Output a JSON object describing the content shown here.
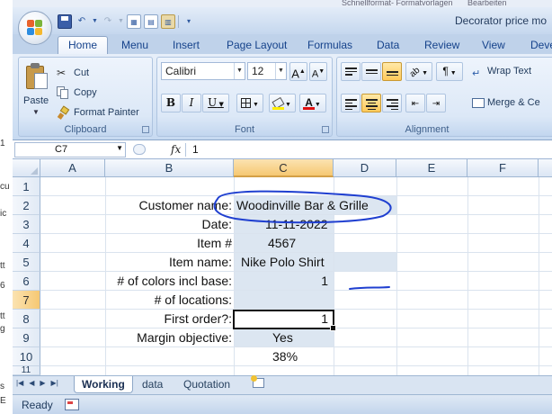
{
  "background": {
    "top_snippets": [
      "Schnellformat- Formatvorlagen",
      "Bearbeiten"
    ],
    "left_snippets": [
      "1",
      "cu",
      "ic",
      "tt",
      "6",
      "tt",
      "g",
      "s",
      "E"
    ]
  },
  "window": {
    "title": "Decorator price mo"
  },
  "ribbon_tabs": [
    "Home",
    "Menu",
    "Insert",
    "Page Layout",
    "Formulas",
    "Data",
    "Review",
    "View",
    "Deve"
  ],
  "clipboard": {
    "paste": "Paste",
    "cut": "Cut",
    "copy": "Copy",
    "format_painter": "Format Painter",
    "label": "Clipboard"
  },
  "font": {
    "name": "Calibri",
    "size": "12",
    "grow": "A",
    "shrink": "A",
    "bold": "B",
    "italic": "I",
    "underline": "U",
    "color_letter": "A",
    "label": "Font"
  },
  "alignment": {
    "wrap_text": "Wrap Text",
    "merge": "Merge & Ce",
    "label": "Alignment"
  },
  "formula_bar": {
    "name_box": "C7",
    "fx": "fx",
    "value": "1"
  },
  "columns": [
    "A",
    "B",
    "C",
    "D",
    "E",
    "F"
  ],
  "rows": [
    "1",
    "2",
    "3",
    "4",
    "5",
    "6",
    "7",
    "8",
    "9",
    "10",
    "11"
  ],
  "cells": {
    "labels": [
      "Customer name:",
      "Date:",
      "Item #",
      "Item name:",
      "# of colors incl base:",
      "# of locations:",
      "First order?:",
      "Margin objective:"
    ],
    "values": [
      "Woodinville Bar & Grille",
      "11-11-2022",
      "4567",
      "Nike Polo Shirt",
      "1",
      "1",
      "Yes",
      "38%"
    ]
  },
  "sheet_tabs": [
    "Working",
    "data",
    "Quotation"
  ],
  "status": {
    "text": "Ready"
  },
  "colors": {
    "ribbon": "#d6e4f5",
    "selection_header": "#f6c872",
    "cell_fill": "#dce6f1",
    "ink": "#1f3fd0"
  }
}
